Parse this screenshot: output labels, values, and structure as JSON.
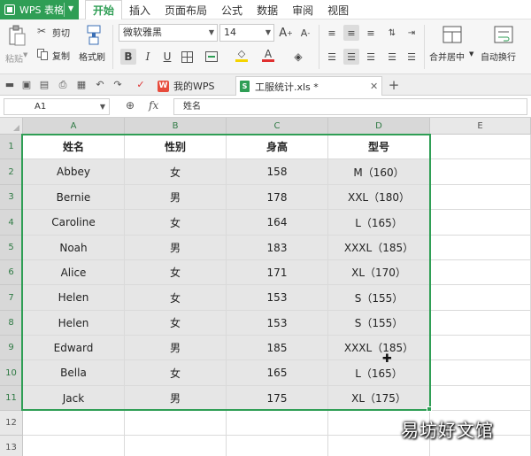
{
  "app": {
    "title": "WPS 表格"
  },
  "menu": {
    "tabs": [
      "开始",
      "插入",
      "页面布局",
      "公式",
      "数据",
      "审阅",
      "视图"
    ],
    "active_index": 0
  },
  "ribbon": {
    "paste_label": "粘贴",
    "cut_label": "剪切",
    "copy_label": "复制",
    "format_painter_label": "格式刷",
    "font_name": "微软雅黑",
    "font_size": "14",
    "merge_label": "合并居中",
    "wrap_label": "自动换行",
    "font_color": "#e03030",
    "fill_color": "#f5d400"
  },
  "doc_tabs": [
    {
      "label": "我的WPS",
      "active": false
    },
    {
      "label": "工服统计.xls *",
      "active": true
    }
  ],
  "formula_bar": {
    "cell_ref": "A1",
    "fx": "fx",
    "content": "姓名"
  },
  "grid": {
    "columns": [
      "A",
      "B",
      "C",
      "D",
      "E"
    ],
    "row_numbers": [
      "1",
      "2",
      "3",
      "4",
      "5",
      "6",
      "7",
      "8",
      "9",
      "10",
      "11",
      "12",
      "13"
    ],
    "header": [
      "姓名",
      "性别",
      "身高",
      "型号"
    ],
    "rows": [
      [
        "Abbey",
        "女",
        "158",
        "M（160）"
      ],
      [
        "Bernie",
        "男",
        "178",
        "XXL（180）"
      ],
      [
        "Caroline",
        "女",
        "164",
        "L（165）"
      ],
      [
        "Noah",
        "男",
        "183",
        "XXXL（185）"
      ],
      [
        "Alice",
        "女",
        "171",
        "XL（170）"
      ],
      [
        "Helen",
        "女",
        "153",
        "S（155）"
      ],
      [
        "Helen",
        "女",
        "153",
        "S（155）"
      ],
      [
        "Edward",
        "男",
        "185",
        "XXXL（185）"
      ],
      [
        "Bella",
        "女",
        "165",
        "L（165）"
      ],
      [
        "Jack",
        "男",
        "175",
        "XL（175）"
      ]
    ]
  },
  "watermark": "易坊好文馆",
  "colors": {
    "accent": "#2f9e55"
  }
}
